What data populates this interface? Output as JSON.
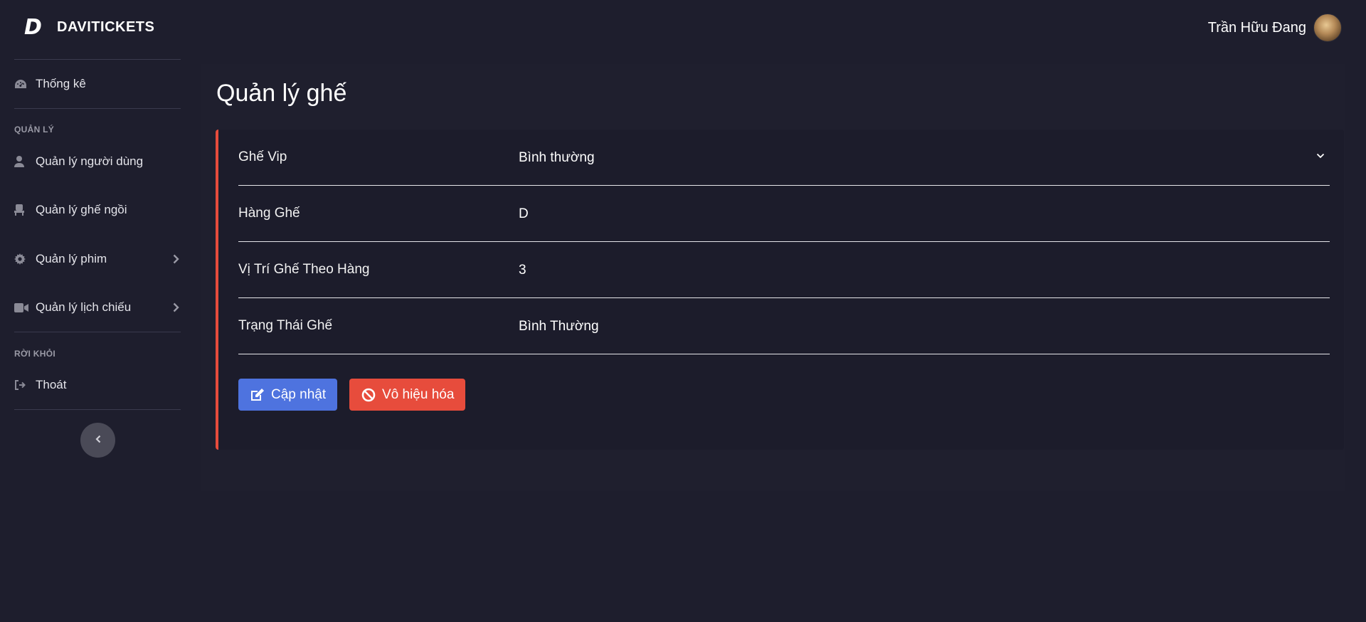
{
  "brand": {
    "logo": "D",
    "name": "DAVITICKETS"
  },
  "user": {
    "name": "Trần Hữu Đang"
  },
  "sidebar": {
    "dashboard": {
      "label": "Thống kê"
    },
    "manage_heading": "QUẢN LÝ",
    "items": [
      {
        "label": "Quản lý người dùng",
        "icon": "user-icon",
        "has_submenu": false
      },
      {
        "label": "Quản lý ghế ngồi",
        "icon": "chair-icon",
        "has_submenu": false
      },
      {
        "label": "Quản lý phim",
        "icon": "gear-icon",
        "has_submenu": true
      },
      {
        "label": "Quản lý lịch chiếu",
        "icon": "video-camera-icon",
        "has_submenu": true
      }
    ],
    "leave_heading": "RỜI KHỎI",
    "logout": {
      "label": "Thoát"
    }
  },
  "main": {
    "title": "Quản lý ghế",
    "fields": [
      {
        "label": "Ghế Vip",
        "value": "Bình thường",
        "type": "select"
      },
      {
        "label": "Hàng Ghế",
        "value": "D",
        "type": "text"
      },
      {
        "label": "Vị Trí Ghế Theo Hàng",
        "value": "3",
        "type": "text"
      },
      {
        "label": "Trạng Thái Ghế",
        "value": "Bình Thường",
        "type": "text"
      }
    ],
    "buttons": {
      "update_label": "Cập nhật",
      "disable_label": "Vô hiệu hóa"
    }
  },
  "colors": {
    "background": "#1e1e2d",
    "card_accent": "#e74c3c",
    "primary": "#4e73df",
    "danger": "#e74c3c"
  }
}
